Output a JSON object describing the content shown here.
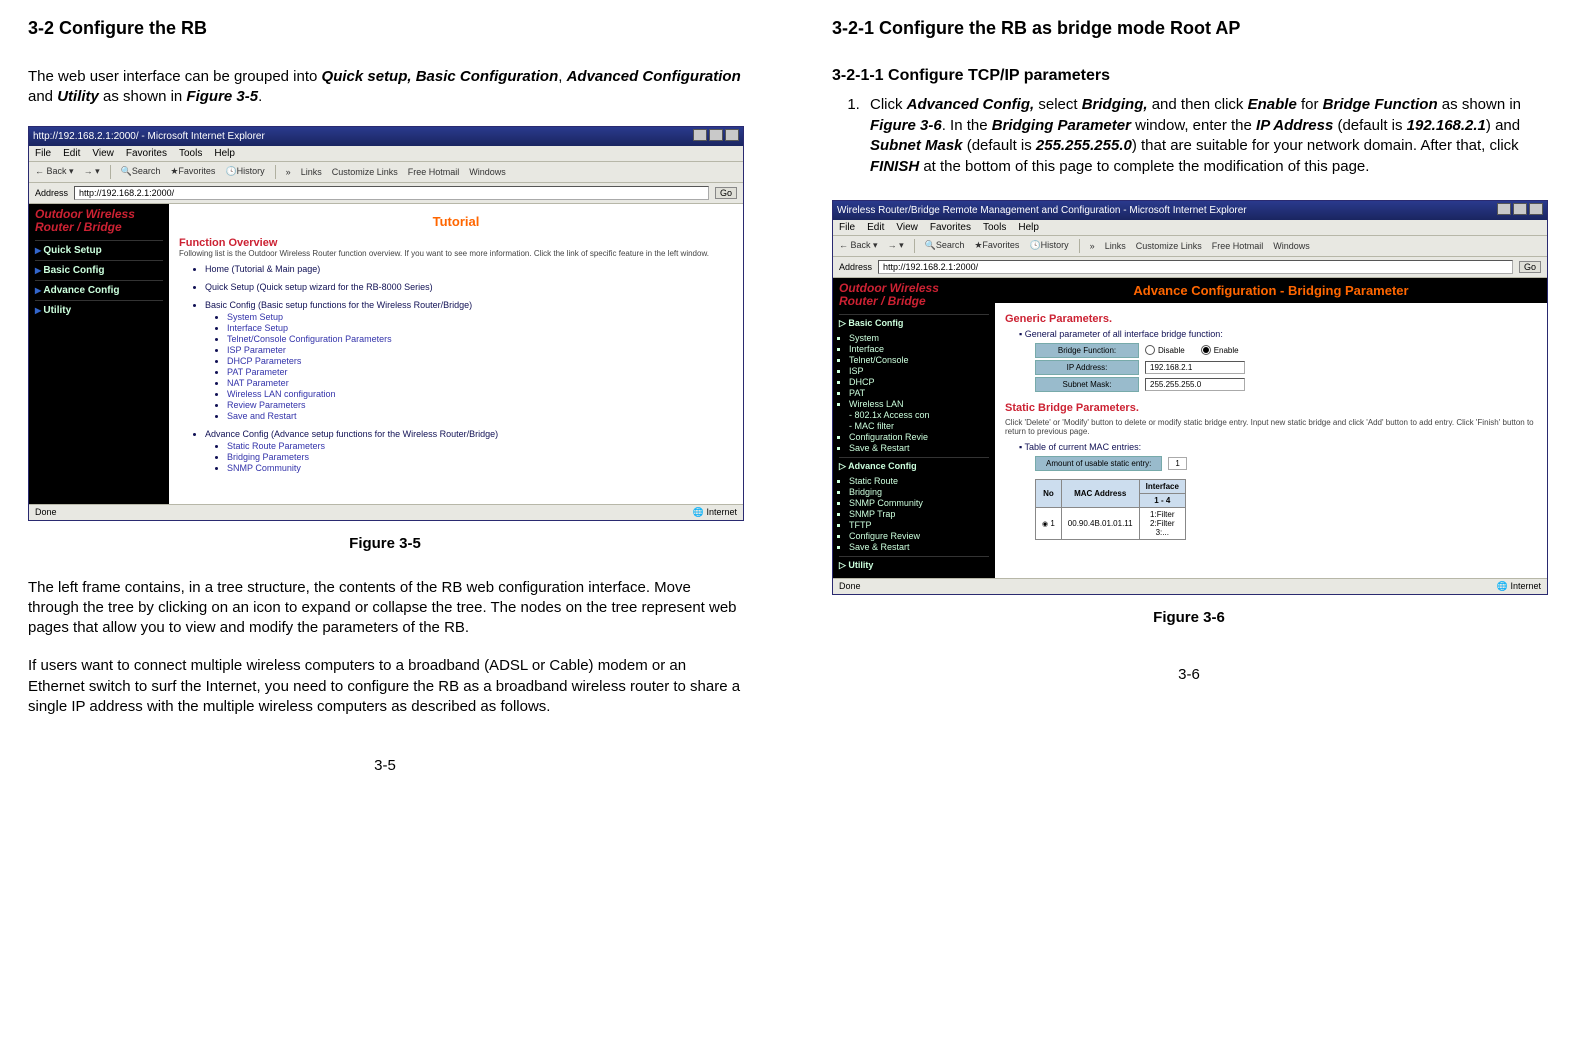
{
  "left": {
    "heading": "3-2 Configure the RB",
    "intro_pre": "The web user interface can be grouped into ",
    "intro_q": "Quick setup, Basic Configuration",
    "intro_comma": ", ",
    "intro_adv": "Advanced Configuration",
    "intro_and": " and ",
    "intro_util": "Utility",
    "intro_as": " as shown in ",
    "intro_fig": "Figure 3-5",
    "intro_dot": ".",
    "fig5": {
      "title": "http://192.168.2.1:2000/ - Microsoft Internet Explorer",
      "menu": [
        "File",
        "Edit",
        "View",
        "Favorites",
        "Tools",
        "Help"
      ],
      "toolbar": {
        "back": "Back",
        "search": "Search",
        "fav": "Favorites",
        "hist": "History",
        "links": "Links",
        "cust": "Customize Links",
        "hot": "Free Hotmail",
        "win": "Windows"
      },
      "addr_label": "Address",
      "addr": "http://192.168.2.1:2000/",
      "go": "Go",
      "brand1": "Outdoor Wireless",
      "brand2": "Router / Bridge",
      "nav": [
        "Quick Setup",
        "Basic Config",
        "Advance Config",
        "Utility"
      ],
      "tutorial": "Tutorial",
      "ov_title": "Function Overview",
      "ov_desc": "Following list is the Outdoor Wireless Router function overview. If you want to see more information. Click the link of specific feature in the left window.",
      "items": {
        "home": "Home (Tutorial & Main page)",
        "quick": "Quick Setup (Quick setup wizard for the RB-8000 Series)",
        "basic": "Basic Config (Basic setup functions for the Wireless Router/Bridge)",
        "basic_subs": [
          "System Setup",
          "Interface Setup",
          "Telnet/Console Configuration Parameters",
          "ISP Parameter",
          "DHCP Parameters",
          "PAT Parameter",
          "NAT Parameter",
          "Wireless LAN configuration",
          "Review Parameters",
          "Save and Restart"
        ],
        "adv": "Advance Config (Advance setup functions for the Wireless Router/Bridge)",
        "adv_subs": [
          "Static Route Parameters",
          "Bridging Parameters",
          "SNMP Community"
        ]
      },
      "status_left": "Done",
      "status_right": "Internet"
    },
    "caption5": "Figure 3-5",
    "para_tree": "The left frame contains, in a tree structure, the contents of the RB web configuration interface. Move through the tree by clicking on an icon to expand or collapse the tree. The nodes on the tree represent web pages that allow you to view and modify the parameters of the RB.",
    "para_broadband": "If users want to connect multiple wireless computers to a broadband (ADSL or Cable) modem or an Ethernet switch to surf the Internet, you need to configure the RB as a broadband wireless router to share a single IP address with the multiple wireless computers as described as follows.",
    "pagenum": "3-5"
  },
  "right": {
    "heading": "3-2-1 Configure the RB as bridge mode Root AP",
    "subheading": "3-2-1-1 Configure TCP/IP parameters",
    "step1": {
      "t1": "Click ",
      "adv": "Advanced Config,",
      "t2": " select ",
      "brg": "Bridging,",
      "t3": " and then click ",
      "en": "Enable",
      "t4": " for ",
      "bf": "Bridge Function",
      "t5": " as shown in ",
      "fig": "Figure 3-6",
      "t6": ". In the ",
      "bp": "Bridging Parameter",
      "t7": " window, enter the ",
      "ip": "IP Address",
      "t8": " (default is ",
      "ipv": "192.168.2.1",
      "t9": ") and ",
      "sn": "Subnet Mask",
      "t10": " (default is ",
      "snv": "255.255.255.0",
      "t11": ") that are suitable for your network domain. After that, click ",
      "fin": "FINISH",
      "t12": " at the bottom of this page to complete the modification of this page."
    },
    "fig6": {
      "title": "Wireless Router/Bridge Remote Management and Configuration - Microsoft Internet Explorer",
      "menu": [
        "File",
        "Edit",
        "View",
        "Favorites",
        "Tools",
        "Help"
      ],
      "toolbar": {
        "back": "Back",
        "search": "Search",
        "fav": "Favorites",
        "hist": "History",
        "links": "Links",
        "cust": "Customize Links",
        "hot": "Free Hotmail",
        "win": "Windows"
      },
      "addr_label": "Address",
      "addr": "http://192.168.2.1:2000/",
      "go": "Go",
      "brand1": "Outdoor Wireless",
      "brand2": "Router / Bridge",
      "side": {
        "basic": "Basic Config",
        "basic_items": [
          "System",
          "Interface",
          "Telnet/Console",
          "ISP",
          "DHCP",
          "PAT",
          "Wireless LAN",
          "  - 802.1x Access con",
          "  - MAC filter",
          "Configuration Revie",
          "Save & Restart"
        ],
        "adv": "Advance Config",
        "adv_items": [
          "Static Route",
          "Bridging",
          "SNMP Community",
          "SNMP Trap",
          "TFTP",
          "Configure Review",
          "Save & Restart"
        ],
        "util": "Utility"
      },
      "main": {
        "hdr": "Advance Configuration - Bridging Parameter",
        "generic": "Generic Parameters.",
        "gen_bullet": "General parameter of all interface bridge function:",
        "bf_label": "Bridge Function:",
        "disable": "Disable",
        "enable": "Enable",
        "ip_label": "IP Address:",
        "ip_val": "192.168.2.1",
        "sn_label": "Subnet Mask:",
        "sn_val": "255.255.255.0",
        "static": "Static Bridge Parameters.",
        "static_note": "Click 'Delete' or 'Modify' button to delete or modify static bridge entry. Input new static bridge and click 'Add' button to add entry. Click 'Finish' button to return to previous page.",
        "table_bullet": "Table of current MAC entries:",
        "amount_label": "Amount of usable static entry:",
        "amount_val": "1",
        "th_no": "No",
        "th_mac": "MAC Address",
        "th_if": "Interface",
        "th_if2": "1 - 4",
        "row_no": "1",
        "row_mac": "00.90.4B.01.01.11",
        "row_if": "1:Filter\n2:Filter\n3:..."
      },
      "status_left": "Done",
      "status_right": "Internet"
    },
    "caption6": "Figure 3-6",
    "pagenum": "3-6"
  }
}
